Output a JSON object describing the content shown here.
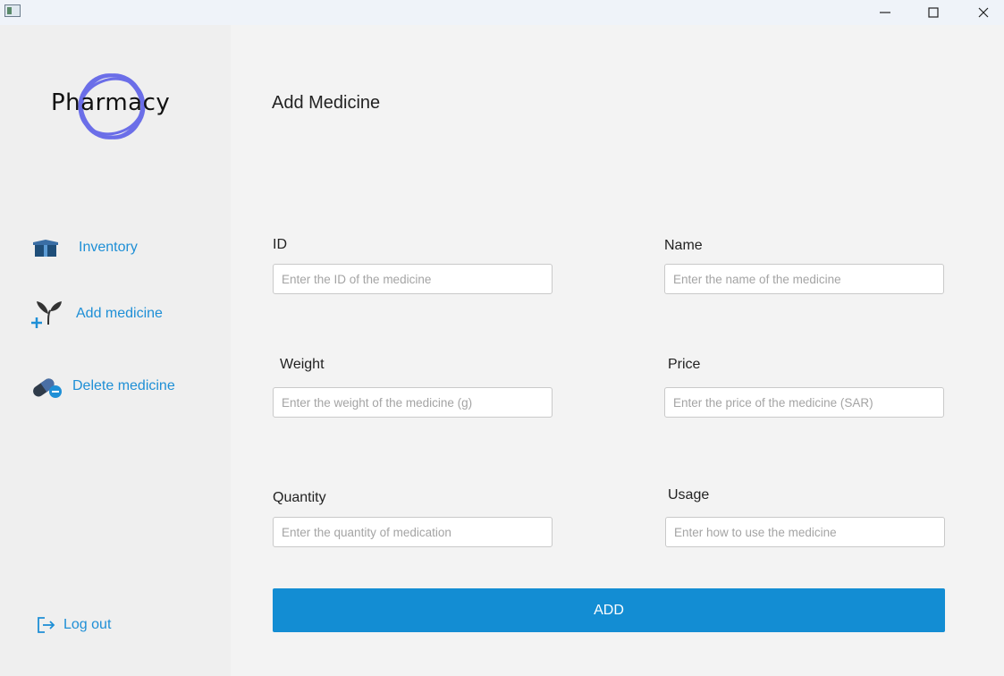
{
  "window": {
    "controls": {
      "minimize_icon": "minimize-icon",
      "maximize_icon": "maximize-icon",
      "close_icon": "close-icon"
    }
  },
  "sidebar": {
    "logo_text": "Pharmacy",
    "items": [
      {
        "label": "Inventory",
        "icon": "box-icon"
      },
      {
        "label": "Add medicine",
        "icon": "plant-plus-icon"
      },
      {
        "label": "Delete medicine",
        "icon": "pill-minus-icon"
      }
    ],
    "logout": {
      "label": "Log out",
      "icon": "logout-icon"
    }
  },
  "main": {
    "title": "Add Medicine",
    "fields": {
      "id": {
        "label": "ID",
        "placeholder": "Enter the ID of the medicine",
        "value": ""
      },
      "name": {
        "label": "Name",
        "placeholder": "Enter the name of the medicine",
        "value": ""
      },
      "weight": {
        "label": "Weight",
        "placeholder": "Enter the weight of the medicine (g)",
        "value": ""
      },
      "price": {
        "label": "Price",
        "placeholder": "Enter the price of the medicine (SAR)",
        "value": ""
      },
      "quantity": {
        "label": "Quantity",
        "placeholder": "Enter the quantity of medication",
        "value": ""
      },
      "usage": {
        "label": "Usage",
        "placeholder": "Enter how to use the medicine",
        "value": ""
      }
    },
    "submit_label": "ADD"
  },
  "colors": {
    "accent": "#1e8fd6",
    "button": "#138dd3",
    "logo_ring": "#6b6ee8",
    "sidebar_bg": "#efefef",
    "main_bg": "#f3f3f3"
  }
}
